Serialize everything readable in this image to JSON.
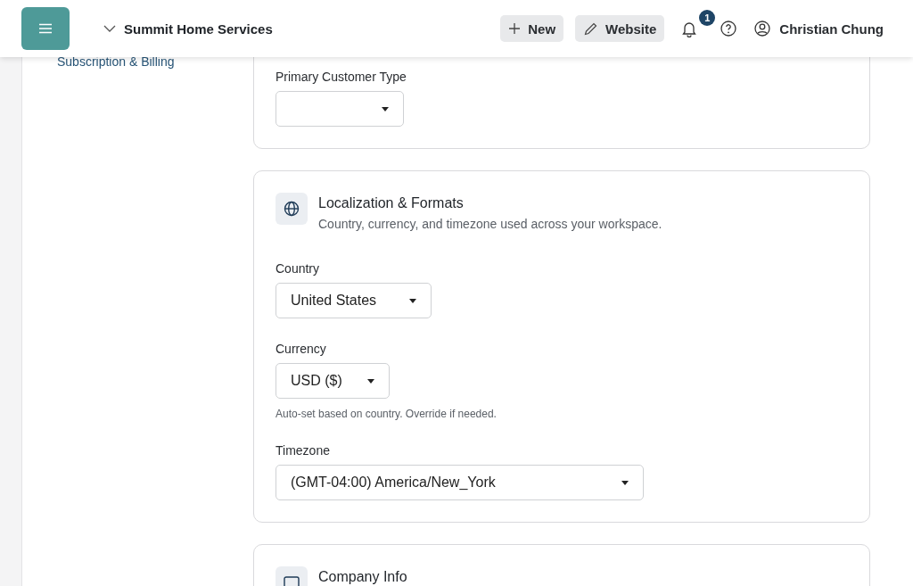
{
  "header": {
    "workspace": "Summit Home Services",
    "buttons": [
      {
        "kind": "new",
        "label": "New"
      },
      {
        "kind": "edit",
        "label": "Website"
      }
    ],
    "notifications": "1",
    "user": "Christian Chung"
  },
  "sidebar": {
    "items": [
      {
        "label": "Subscription & Billing"
      }
    ]
  },
  "sections": [
    {
      "fields": [
        {
          "label": "Primary Customer Type"
        }
      ]
    },
    {
      "title": "Localization & Formats",
      "subtitle": "Country, currency, and timezone used across your workspace.",
      "kind": "globe",
      "fields": [
        {
          "label": "Country",
          "value": "United States"
        },
        {
          "label": "Currency",
          "value": "USD ($)",
          "hint": "Auto-set based on country. Override if needed."
        },
        {
          "label": "Timezone",
          "value": "(GMT-04:00) America/New_York"
        }
      ]
    },
    {
      "title": "Company Info",
      "kind": "card"
    }
  ]
}
